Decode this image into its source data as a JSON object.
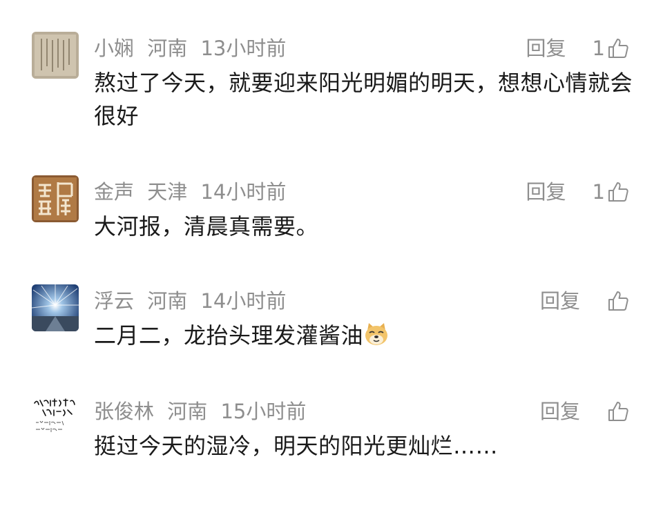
{
  "comments": [
    {
      "name": "小娴",
      "location": "河南",
      "time": "13小时前",
      "reply_label": "回复",
      "like_count": "1",
      "text": "熬过了今天，就要迎来阳光明媚的明天，想想心情就会很好"
    },
    {
      "name": "金声",
      "location": "天津",
      "time": "14小时前",
      "reply_label": "回复",
      "like_count": "1",
      "text": "大河报，清晨真需要。"
    },
    {
      "name": "浮云",
      "location": "河南",
      "time": "14小时前",
      "reply_label": "回复",
      "like_count": "",
      "text": "二月二，龙抬头理发灌酱油",
      "emoji": "doge-emoji"
    },
    {
      "name": "张俊林",
      "location": "河南",
      "time": "15小时前",
      "reply_label": "回复",
      "like_count": "",
      "text": "挺过今天的湿冷，明天的阳光更灿烂……"
    }
  ],
  "icons": {
    "like": "thumbs-up-icon"
  },
  "colors": {
    "meta_text": "#8e8e8e",
    "body_text": "#1a1a1a",
    "background": "#ffffff"
  }
}
